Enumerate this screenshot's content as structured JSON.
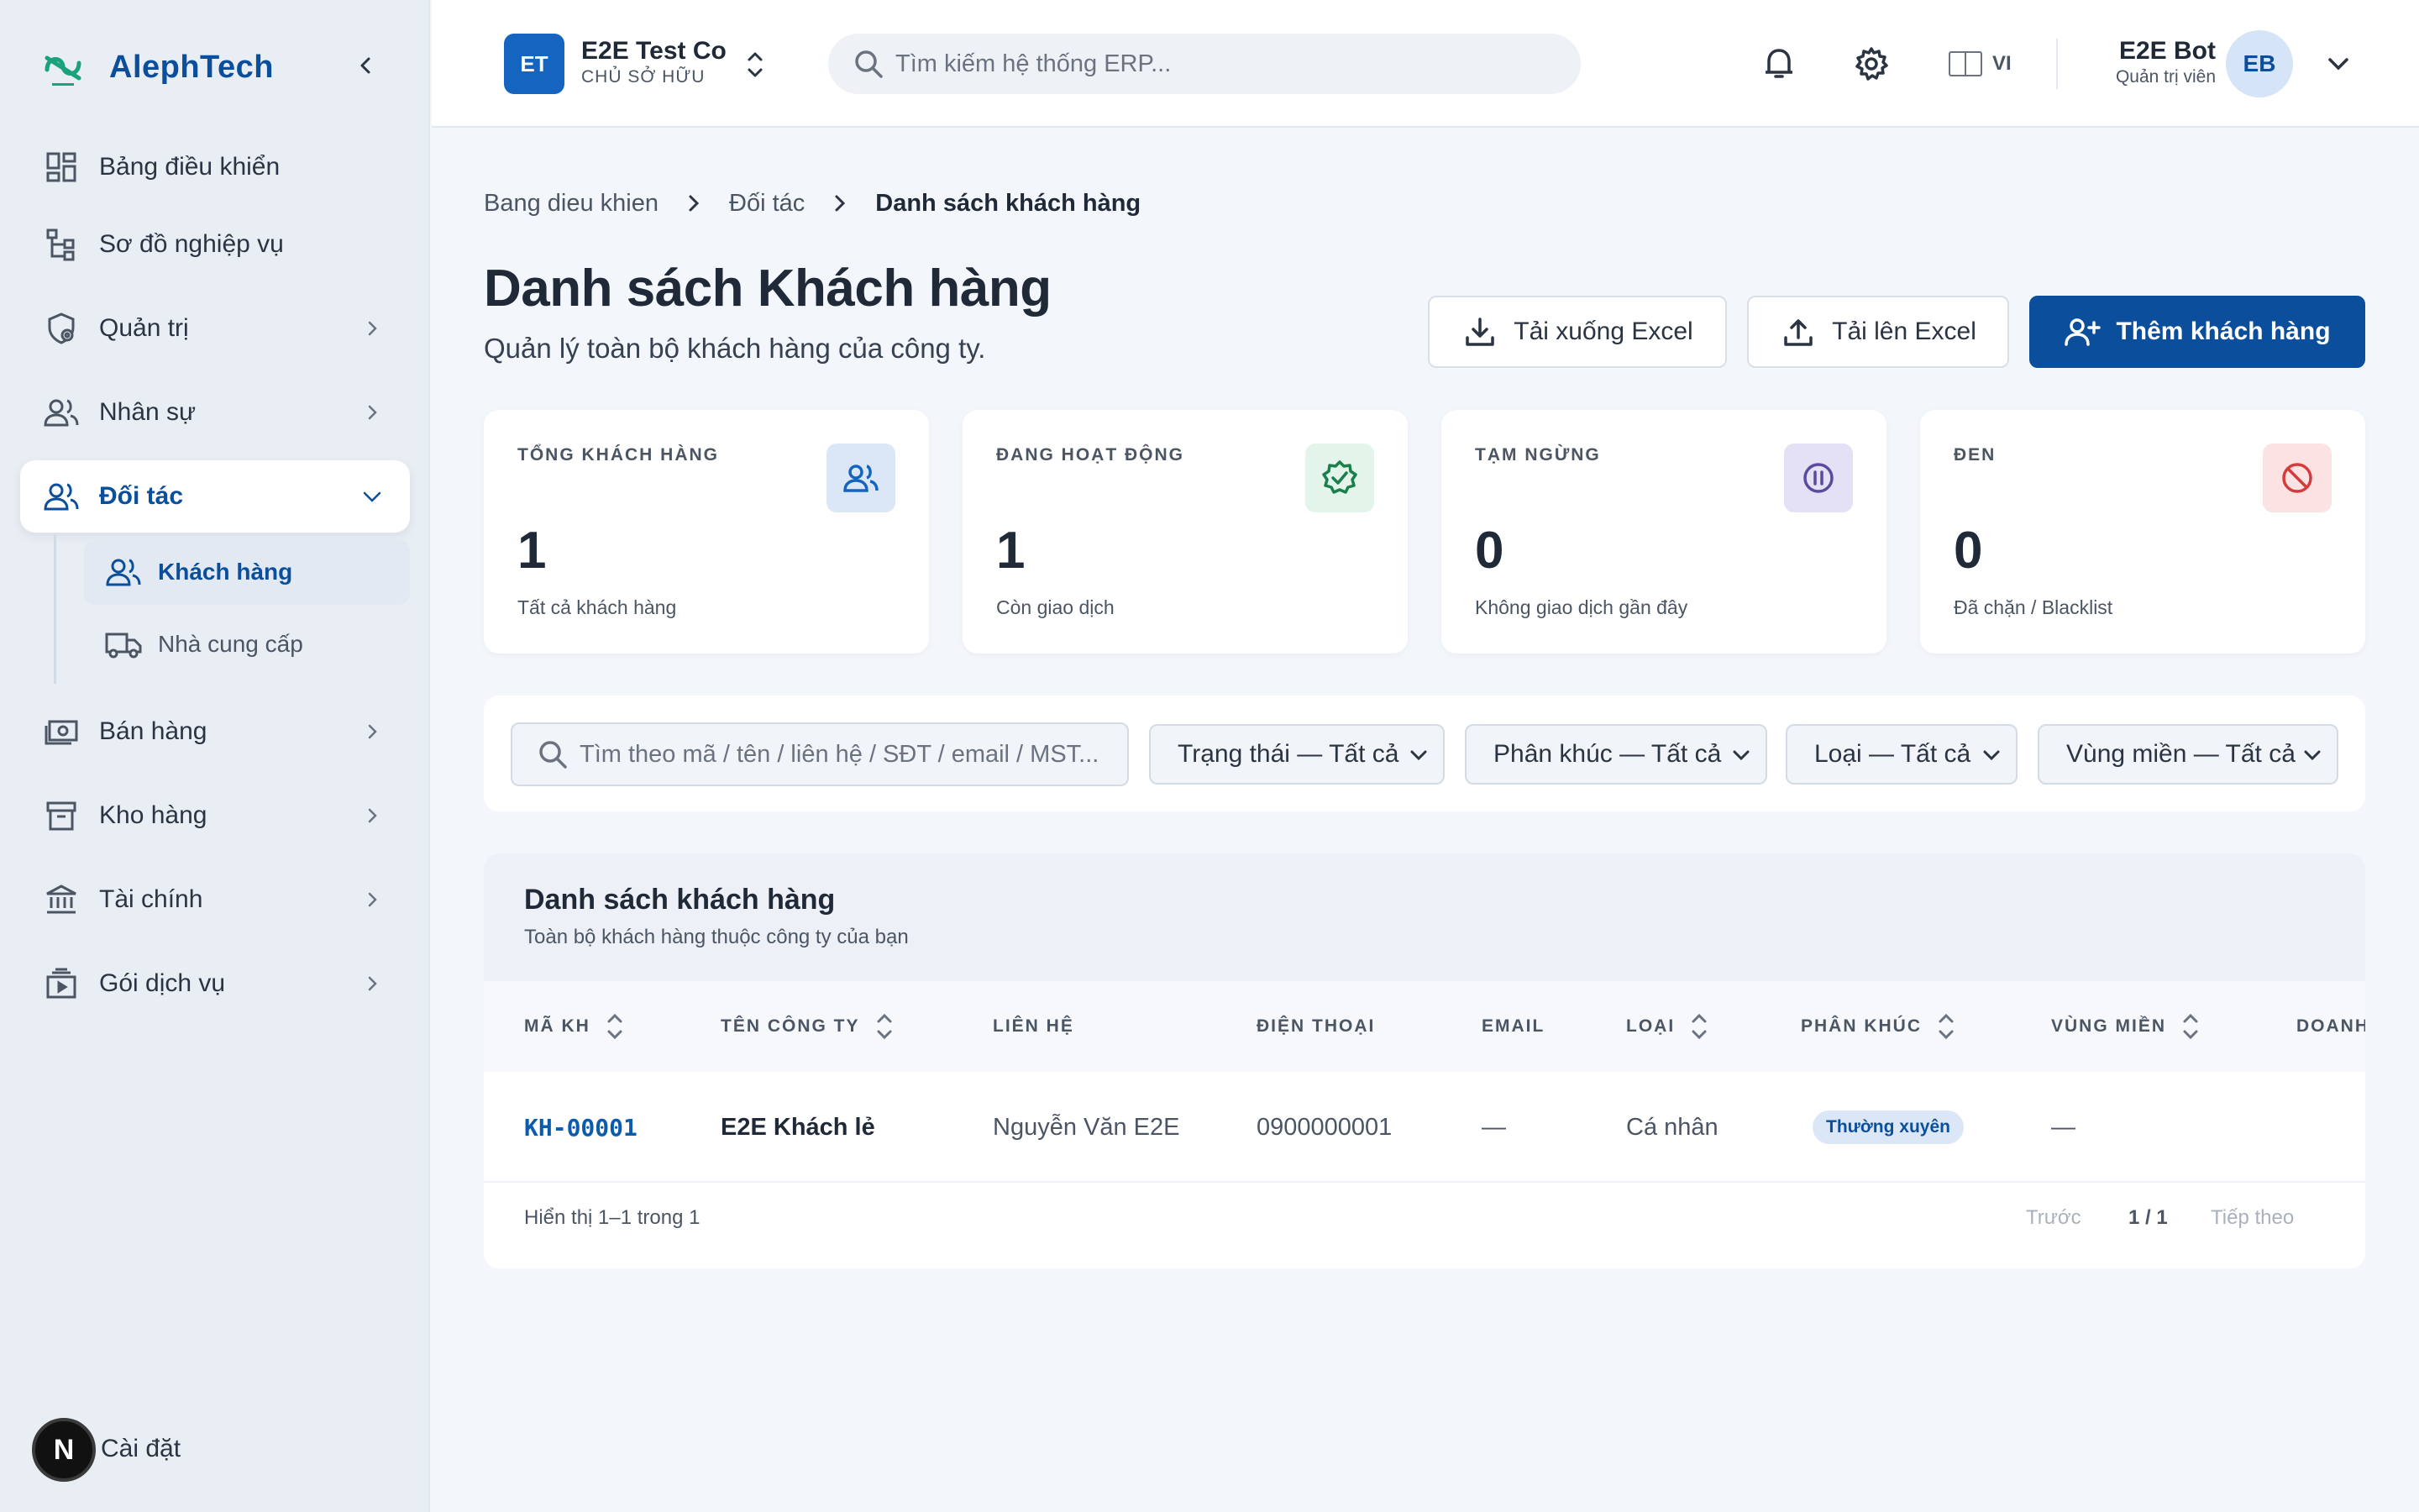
{
  "sidebar": {
    "brand": "AlephTech",
    "items": [
      {
        "label": "Bảng điều khiển",
        "icon": "dashboard-icon"
      },
      {
        "label": "Sơ đồ nghiệp vụ",
        "icon": "sitemap-icon"
      },
      {
        "label": "Quản trị",
        "icon": "admin-shield-icon"
      },
      {
        "label": "Nhân sự",
        "icon": "people-icon"
      },
      {
        "label": "Đối tác",
        "icon": "partners-icon"
      },
      {
        "label": "Bán hàng",
        "icon": "cash-icon"
      },
      {
        "label": "Kho hàng",
        "icon": "archive-box-icon"
      },
      {
        "label": "Tài chính",
        "icon": "bank-icon"
      },
      {
        "label": "Gói dịch vụ",
        "icon": "subscription-icon"
      }
    ],
    "sub_items": [
      {
        "label": "Khách hàng",
        "icon": "customers-icon"
      },
      {
        "label": "Nhà cung cấp",
        "icon": "truck-icon"
      }
    ],
    "footer_label": "Cài đặt",
    "footer_avatar": "N"
  },
  "topbar": {
    "company_initials": "ET",
    "company_name": "E2E Test Co",
    "company_role": "CHỦ SỞ HỮU",
    "search_placeholder": "Tìm kiếm hệ thống ERP...",
    "lang": "VI",
    "user_name": "E2E Bot",
    "user_role": "Quản trị viên",
    "user_initials": "EB"
  },
  "breadcrumb": [
    "Bang dieu khien",
    "Đối tác",
    "Danh sách khách hàng"
  ],
  "page": {
    "title": "Danh sách Khách hàng",
    "subtitle": "Quản lý toàn bộ khách hàng của công ty."
  },
  "actions": {
    "download": "Tải xuống Excel",
    "upload": "Tải lên Excel",
    "add": "Thêm khách hàng"
  },
  "stats": [
    {
      "title": "TỔNG KHÁCH HÀNG",
      "value": "1",
      "sub": "Tất cả khách hàng",
      "icon": "users-icon",
      "accent": "#1565c0",
      "bg": "#dbe7f7"
    },
    {
      "title": "ĐANG HOẠT ĐỘNG",
      "value": "1",
      "sub": "Còn giao dịch",
      "icon": "verified-badge-icon",
      "accent": "#1a7f4b",
      "bg": "#e3f4ea"
    },
    {
      "title": "TẠM NGỪNG",
      "value": "0",
      "sub": "Không giao dịch gần đây",
      "icon": "pause-icon",
      "accent": "#5b4a9e",
      "bg": "#e4e0f5"
    },
    {
      "title": "ĐEN",
      "value": "0",
      "sub": "Đã chặn / Blacklist",
      "icon": "blocked-icon",
      "accent": "#d63b3b",
      "bg": "#fbe3e3"
    }
  ],
  "filters": {
    "search_placeholder": "Tìm theo mã / tên / liên hệ / SĐT / email / MST...",
    "status": "Trạng thái — Tất cả",
    "segment": "Phân khúc — Tất cả",
    "type": "Loại — Tất cả",
    "region": "Vùng miền — Tất cả"
  },
  "table": {
    "title": "Danh sách khách hàng",
    "subtitle": "Toàn bộ khách hàng thuộc công ty của bạn",
    "columns": [
      "MÃ KH",
      "TÊN CÔNG TY",
      "LIÊN HỆ",
      "ĐIỆN THOẠI",
      "EMAIL",
      "LOẠI",
      "PHÂN KHÚC",
      "VÙNG MIỀN",
      "DOANH"
    ],
    "rows": [
      {
        "code": "KH-00001",
        "company": "E2E Khách lẻ",
        "contact": "Nguyễn Văn E2E",
        "phone": "0900000001",
        "email": "—",
        "type": "Cá nhân",
        "segment": "Thường xuyên",
        "region": "—"
      }
    ],
    "pager": {
      "info": "Hiển thị 1–1 trong 1",
      "prev": "Trước",
      "page": "1 / 1",
      "next": "Tiếp theo"
    }
  },
  "colors": {
    "brand": "#0b4f9c",
    "primary_button": "#0b4f9c",
    "sidebar_bg": "#e9eef4",
    "page_bg": "#f3f6fa"
  }
}
